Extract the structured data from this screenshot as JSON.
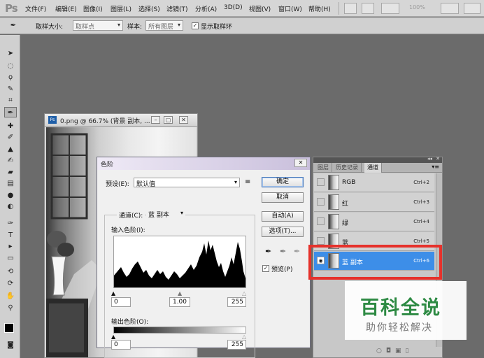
{
  "app": {
    "logo": "Ps"
  },
  "menu": [
    "文件(F)",
    "编辑(E)",
    "图像(I)",
    "图层(L)",
    "选择(S)",
    "滤镜(T)",
    "分析(A)",
    "3D(D)",
    "视图(V)",
    "窗口(W)",
    "帮助(H)"
  ],
  "menubar_zoom": "100%",
  "options_bar": {
    "sample_size_label": "取样大小:",
    "sample_size_value": "取样点",
    "sample_label": "样本:",
    "sample_value": "所有图层",
    "show_ring_label": "显示取样环",
    "show_ring_checked": true
  },
  "tools": [
    "move",
    "marquee",
    "lasso",
    "quick-select",
    "crop",
    "eyedropper",
    "healing",
    "brush",
    "stamp",
    "history-brush",
    "eraser",
    "gradient",
    "blur",
    "dodge",
    "pen",
    "type",
    "path-select",
    "shape",
    "3d-rotate",
    "3d-orbit",
    "hand",
    "zoom"
  ],
  "document": {
    "title": "0.png @ 66.7% (背景 副本, ..."
  },
  "levels": {
    "title": "色阶",
    "preset_label": "预设(E):",
    "preset_value": "默认值",
    "channel_label": "通道(C):",
    "channel_value": "蓝 副本",
    "input_label": "输入色阶(I):",
    "input_values": [
      "0",
      "1.00",
      "255"
    ],
    "output_label": "输出色阶(O):",
    "output_values": [
      "0",
      "255"
    ],
    "buttons": {
      "ok": "确定",
      "cancel": "取消",
      "auto": "自动(A)",
      "options": "选项(T)..."
    },
    "preview_label": "预览(P)",
    "preview_checked": true
  },
  "channels_panel": {
    "tabs": [
      "图层",
      "历史记录",
      "通道"
    ],
    "active_tab": "通道",
    "rows": [
      {
        "name": "RGB",
        "shortcut": "Ctrl+2"
      },
      {
        "name": "红",
        "shortcut": "Ctrl+3"
      },
      {
        "name": "绿",
        "shortcut": "Ctrl+4"
      },
      {
        "name": "蓝",
        "shortcut": "Ctrl+5"
      },
      {
        "name": "蓝 副本",
        "shortcut": "Ctrl+6"
      }
    ],
    "selected_index": 4
  },
  "watermark": {
    "title": "百科全说",
    "subtitle": "助你轻松解决"
  },
  "colors": {
    "selected_row": "#3d8ee8",
    "highlight": "#e6312b",
    "watermark": "#2d8a43"
  }
}
